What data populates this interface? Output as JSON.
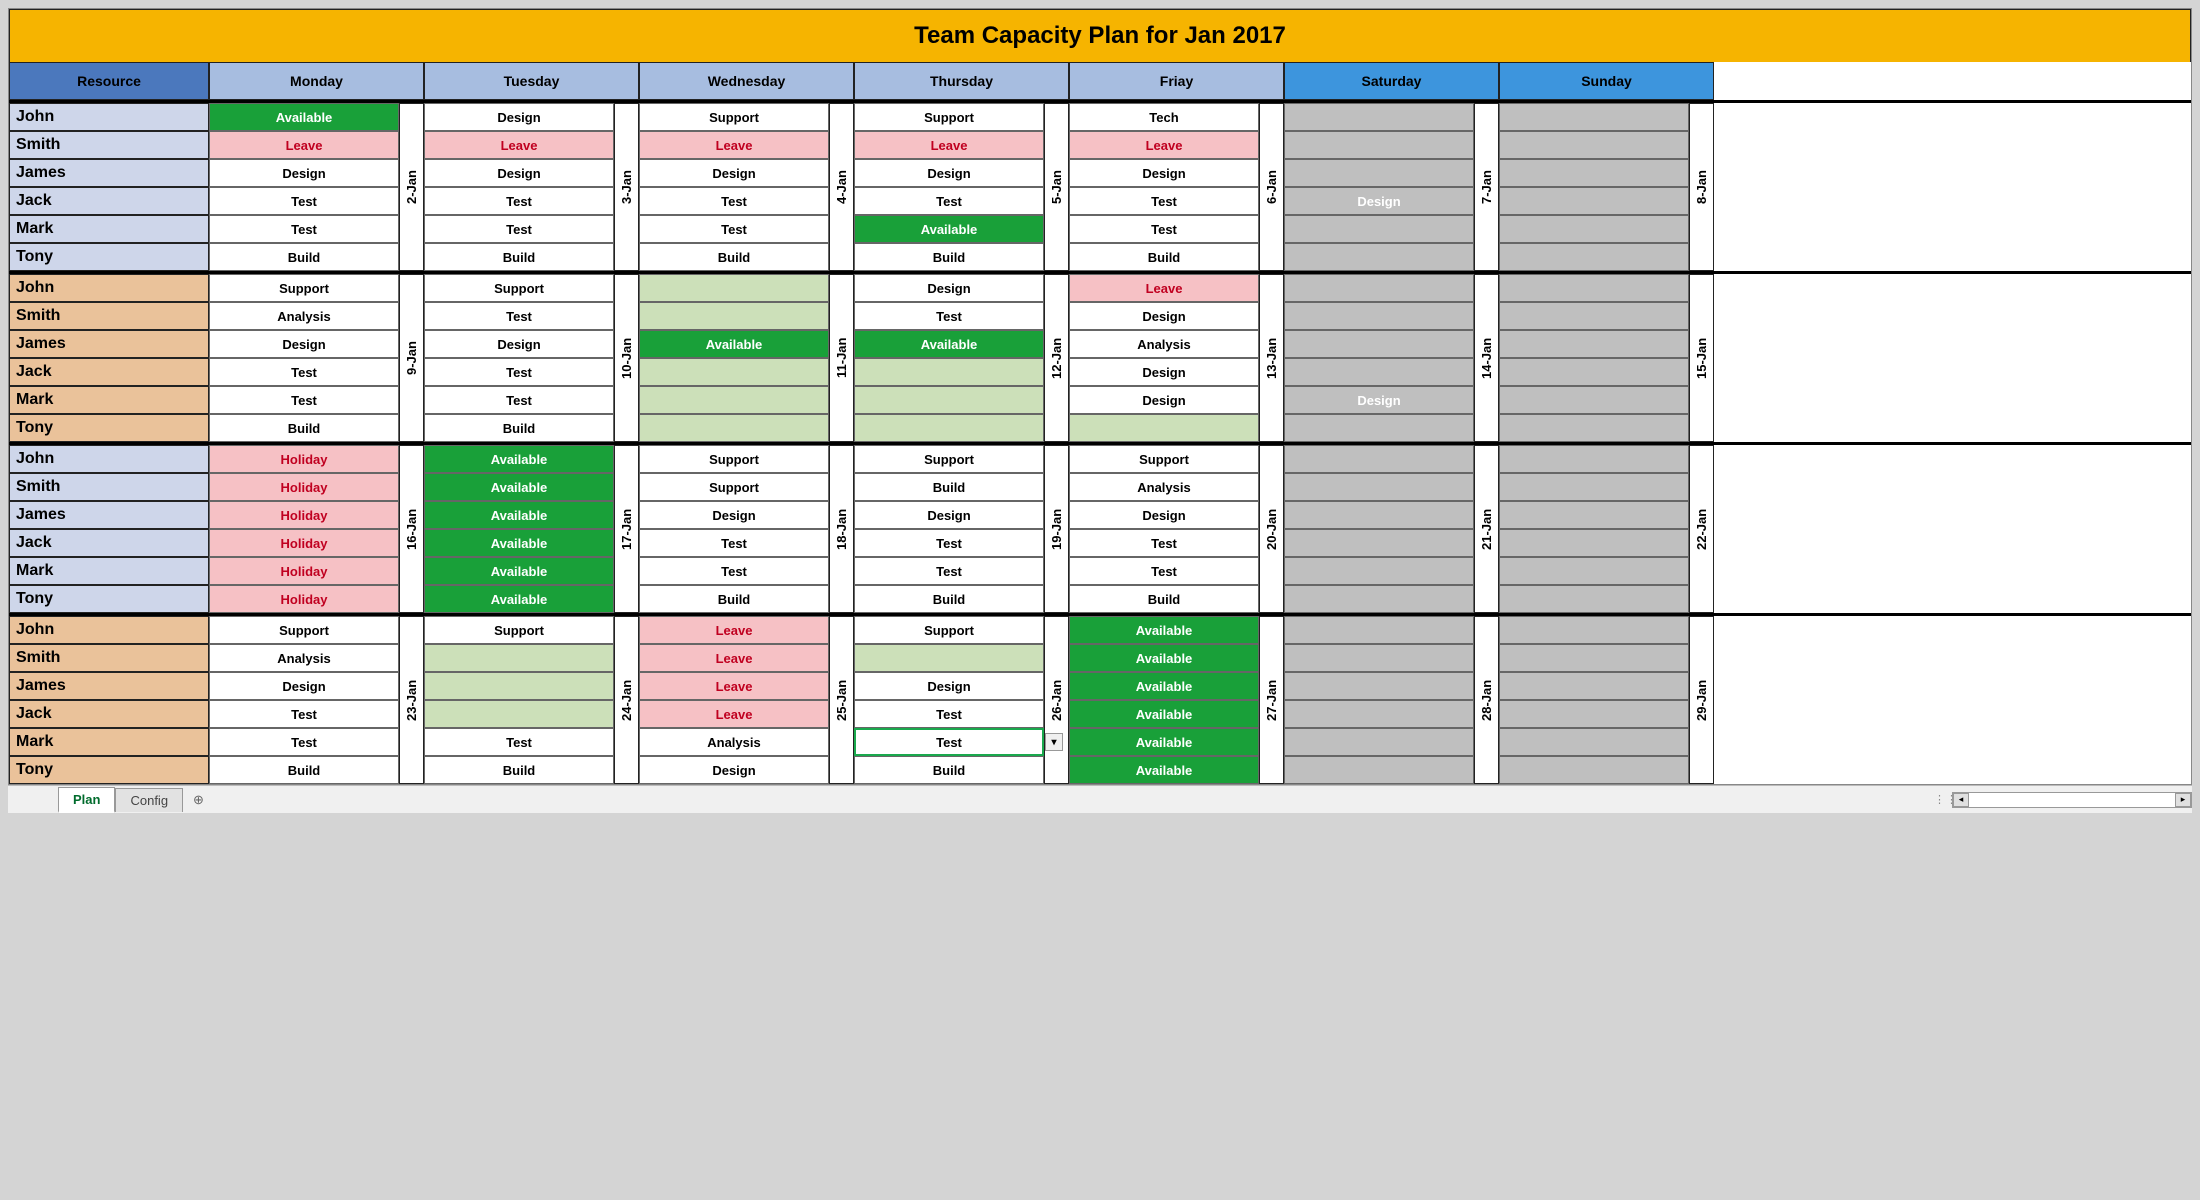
{
  "title": "Team Capacity Plan for Jan 2017",
  "headers": {
    "resource": "Resource",
    "days": [
      "Monday",
      "Tuesday",
      "Wednesday",
      "Thursday",
      "Friay",
      "Saturday",
      "Sunday"
    ]
  },
  "resources": [
    "John",
    "Smith",
    "James",
    "Jack",
    "Mark",
    "Tony"
  ],
  "weeks": [
    {
      "res_bg": "odd",
      "dates": [
        "2-Jan",
        "3-Jan",
        "4-Jan",
        "5-Jan",
        "6-Jan",
        "7-Jan",
        "8-Jan"
      ],
      "grid": {
        "John": [
          {
            "t": "Available",
            "c": "avail"
          },
          {
            "t": "Design",
            "c": "white"
          },
          {
            "t": "Support",
            "c": "white"
          },
          {
            "t": "Support",
            "c": "white"
          },
          {
            "t": "Tech",
            "c": "white"
          },
          {
            "t": "",
            "c": "grey"
          },
          {
            "t": "",
            "c": "grey"
          }
        ],
        "Smith": [
          {
            "t": "Leave",
            "c": "leave"
          },
          {
            "t": "Leave",
            "c": "leave"
          },
          {
            "t": "Leave",
            "c": "leave"
          },
          {
            "t": "Leave",
            "c": "leave"
          },
          {
            "t": "Leave",
            "c": "leave"
          },
          {
            "t": "",
            "c": "grey"
          },
          {
            "t": "",
            "c": "grey"
          }
        ],
        "James": [
          {
            "t": "Design",
            "c": "white"
          },
          {
            "t": "Design",
            "c": "white"
          },
          {
            "t": "Design",
            "c": "white"
          },
          {
            "t": "Design",
            "c": "white"
          },
          {
            "t": "Design",
            "c": "white"
          },
          {
            "t": "",
            "c": "grey"
          },
          {
            "t": "",
            "c": "grey"
          }
        ],
        "Jack": [
          {
            "t": "Test",
            "c": "white"
          },
          {
            "t": "Test",
            "c": "white"
          },
          {
            "t": "Test",
            "c": "white"
          },
          {
            "t": "Test",
            "c": "white"
          },
          {
            "t": "Test",
            "c": "white"
          },
          {
            "t": "Design",
            "c": "red"
          },
          {
            "t": "",
            "c": "grey"
          }
        ],
        "Mark": [
          {
            "t": "Test",
            "c": "white"
          },
          {
            "t": "Test",
            "c": "white"
          },
          {
            "t": "Test",
            "c": "white"
          },
          {
            "t": "Available",
            "c": "avail"
          },
          {
            "t": "Test",
            "c": "white"
          },
          {
            "t": "",
            "c": "grey"
          },
          {
            "t": "",
            "c": "grey"
          }
        ],
        "Tony": [
          {
            "t": "Build",
            "c": "white"
          },
          {
            "t": "Build",
            "c": "white"
          },
          {
            "t": "Build",
            "c": "white"
          },
          {
            "t": "Build",
            "c": "white"
          },
          {
            "t": "Build",
            "c": "white"
          },
          {
            "t": "",
            "c": "grey"
          },
          {
            "t": "",
            "c": "grey"
          }
        ]
      }
    },
    {
      "res_bg": "even",
      "dates": [
        "9-Jan",
        "10-Jan",
        "11-Jan",
        "12-Jan",
        "13-Jan",
        "14-Jan",
        "15-Jan"
      ],
      "grid": {
        "John": [
          {
            "t": "Support",
            "c": "white"
          },
          {
            "t": "Support",
            "c": "white"
          },
          {
            "t": "",
            "c": "palegrn"
          },
          {
            "t": "Design",
            "c": "white"
          },
          {
            "t": "Leave",
            "c": "leave"
          },
          {
            "t": "",
            "c": "grey"
          },
          {
            "t": "",
            "c": "grey"
          }
        ],
        "Smith": [
          {
            "t": "Analysis",
            "c": "white"
          },
          {
            "t": "Test",
            "c": "white"
          },
          {
            "t": "",
            "c": "palegrn"
          },
          {
            "t": "Test",
            "c": "white"
          },
          {
            "t": "Design",
            "c": "white"
          },
          {
            "t": "",
            "c": "grey"
          },
          {
            "t": "",
            "c": "grey"
          }
        ],
        "James": [
          {
            "t": "Design",
            "c": "white"
          },
          {
            "t": "Design",
            "c": "white"
          },
          {
            "t": "Available",
            "c": "avail"
          },
          {
            "t": "Available",
            "c": "avail"
          },
          {
            "t": "Analysis",
            "c": "white"
          },
          {
            "t": "",
            "c": "grey"
          },
          {
            "t": "",
            "c": "grey"
          }
        ],
        "Jack": [
          {
            "t": "Test",
            "c": "white"
          },
          {
            "t": "Test",
            "c": "white"
          },
          {
            "t": "",
            "c": "palegrn"
          },
          {
            "t": "",
            "c": "palegrn"
          },
          {
            "t": "Design",
            "c": "white"
          },
          {
            "t": "",
            "c": "grey"
          },
          {
            "t": "",
            "c": "grey"
          }
        ],
        "Mark": [
          {
            "t": "Test",
            "c": "white"
          },
          {
            "t": "Test",
            "c": "white"
          },
          {
            "t": "",
            "c": "palegrn"
          },
          {
            "t": "",
            "c": "palegrn"
          },
          {
            "t": "Design",
            "c": "white"
          },
          {
            "t": "Design",
            "c": "red"
          },
          {
            "t": "",
            "c": "grey"
          }
        ],
        "Tony": [
          {
            "t": "Build",
            "c": "white"
          },
          {
            "t": "Build",
            "c": "white"
          },
          {
            "t": "",
            "c": "palegrn"
          },
          {
            "t": "",
            "c": "palegrn"
          },
          {
            "t": "",
            "c": "palegrn"
          },
          {
            "t": "",
            "c": "grey"
          },
          {
            "t": "",
            "c": "grey"
          }
        ]
      }
    },
    {
      "res_bg": "odd",
      "dates": [
        "16-Jan",
        "17-Jan",
        "18-Jan",
        "19-Jan",
        "20-Jan",
        "21-Jan",
        "22-Jan"
      ],
      "grid": {
        "John": [
          {
            "t": "Holiday",
            "c": "holiday"
          },
          {
            "t": "Available",
            "c": "avail"
          },
          {
            "t": "Support",
            "c": "white"
          },
          {
            "t": "Support",
            "c": "white"
          },
          {
            "t": "Support",
            "c": "white"
          },
          {
            "t": "",
            "c": "grey"
          },
          {
            "t": "",
            "c": "grey"
          }
        ],
        "Smith": [
          {
            "t": "Holiday",
            "c": "holiday"
          },
          {
            "t": "Available",
            "c": "avail"
          },
          {
            "t": "Support",
            "c": "white"
          },
          {
            "t": "Build",
            "c": "white"
          },
          {
            "t": "Analysis",
            "c": "white"
          },
          {
            "t": "",
            "c": "grey"
          },
          {
            "t": "",
            "c": "grey"
          }
        ],
        "James": [
          {
            "t": "Holiday",
            "c": "holiday"
          },
          {
            "t": "Available",
            "c": "avail"
          },
          {
            "t": "Design",
            "c": "white"
          },
          {
            "t": "Design",
            "c": "white"
          },
          {
            "t": "Design",
            "c": "white"
          },
          {
            "t": "",
            "c": "grey"
          },
          {
            "t": "",
            "c": "grey"
          }
        ],
        "Jack": [
          {
            "t": "Holiday",
            "c": "holiday"
          },
          {
            "t": "Available",
            "c": "avail"
          },
          {
            "t": "Test",
            "c": "white"
          },
          {
            "t": "Test",
            "c": "white"
          },
          {
            "t": "Test",
            "c": "white"
          },
          {
            "t": "",
            "c": "grey"
          },
          {
            "t": "",
            "c": "grey"
          }
        ],
        "Mark": [
          {
            "t": "Holiday",
            "c": "holiday"
          },
          {
            "t": "Available",
            "c": "avail"
          },
          {
            "t": "Test",
            "c": "white"
          },
          {
            "t": "Test",
            "c": "white"
          },
          {
            "t": "Test",
            "c": "white"
          },
          {
            "t": "",
            "c": "grey"
          },
          {
            "t": "",
            "c": "grey"
          }
        ],
        "Tony": [
          {
            "t": "Holiday",
            "c": "holiday"
          },
          {
            "t": "Available",
            "c": "avail"
          },
          {
            "t": "Build",
            "c": "white"
          },
          {
            "t": "Build",
            "c": "white"
          },
          {
            "t": "Build",
            "c": "white"
          },
          {
            "t": "",
            "c": "grey"
          },
          {
            "t": "",
            "c": "grey"
          }
        ]
      }
    },
    {
      "res_bg": "even",
      "dates": [
        "23-Jan",
        "24-Jan",
        "25-Jan",
        "26-Jan",
        "27-Jan",
        "28-Jan",
        "29-Jan"
      ],
      "grid": {
        "John": [
          {
            "t": "Support",
            "c": "white"
          },
          {
            "t": "Support",
            "c": "white"
          },
          {
            "t": "Leave",
            "c": "leave"
          },
          {
            "t": "Support",
            "c": "white"
          },
          {
            "t": "Available",
            "c": "avail"
          },
          {
            "t": "",
            "c": "grey"
          },
          {
            "t": "",
            "c": "grey"
          }
        ],
        "Smith": [
          {
            "t": "Analysis",
            "c": "white"
          },
          {
            "t": "",
            "c": "palegrn"
          },
          {
            "t": "Leave",
            "c": "leave"
          },
          {
            "t": "",
            "c": "palegrn"
          },
          {
            "t": "Available",
            "c": "avail"
          },
          {
            "t": "",
            "c": "grey"
          },
          {
            "t": "",
            "c": "grey"
          }
        ],
        "James": [
          {
            "t": "Design",
            "c": "white"
          },
          {
            "t": "",
            "c": "palegrn"
          },
          {
            "t": "Leave",
            "c": "leave"
          },
          {
            "t": "Design",
            "c": "white"
          },
          {
            "t": "Available",
            "c": "avail"
          },
          {
            "t": "",
            "c": "grey"
          },
          {
            "t": "",
            "c": "grey"
          }
        ],
        "Jack": [
          {
            "t": "Test",
            "c": "white"
          },
          {
            "t": "",
            "c": "palegrn"
          },
          {
            "t": "Leave",
            "c": "leave"
          },
          {
            "t": "Test",
            "c": "white"
          },
          {
            "t": "Available",
            "c": "avail"
          },
          {
            "t": "",
            "c": "grey"
          },
          {
            "t": "",
            "c": "grey"
          }
        ],
        "Mark": [
          {
            "t": "Test",
            "c": "white"
          },
          {
            "t": "Test",
            "c": "white"
          },
          {
            "t": "Analysis",
            "c": "white"
          },
          {
            "t": "Test",
            "c": "white",
            "sel": true
          },
          {
            "t": "Available",
            "c": "avail"
          },
          {
            "t": "",
            "c": "grey"
          },
          {
            "t": "",
            "c": "grey"
          }
        ],
        "Tony": [
          {
            "t": "Build",
            "c": "white"
          },
          {
            "t": "Build",
            "c": "white"
          },
          {
            "t": "Design",
            "c": "white"
          },
          {
            "t": "Build",
            "c": "white"
          },
          {
            "t": "Available",
            "c": "avail"
          },
          {
            "t": "",
            "c": "grey"
          },
          {
            "t": "",
            "c": "grey"
          }
        ]
      }
    }
  ],
  "tabs": {
    "plan": "Plan",
    "config": "Config"
  }
}
